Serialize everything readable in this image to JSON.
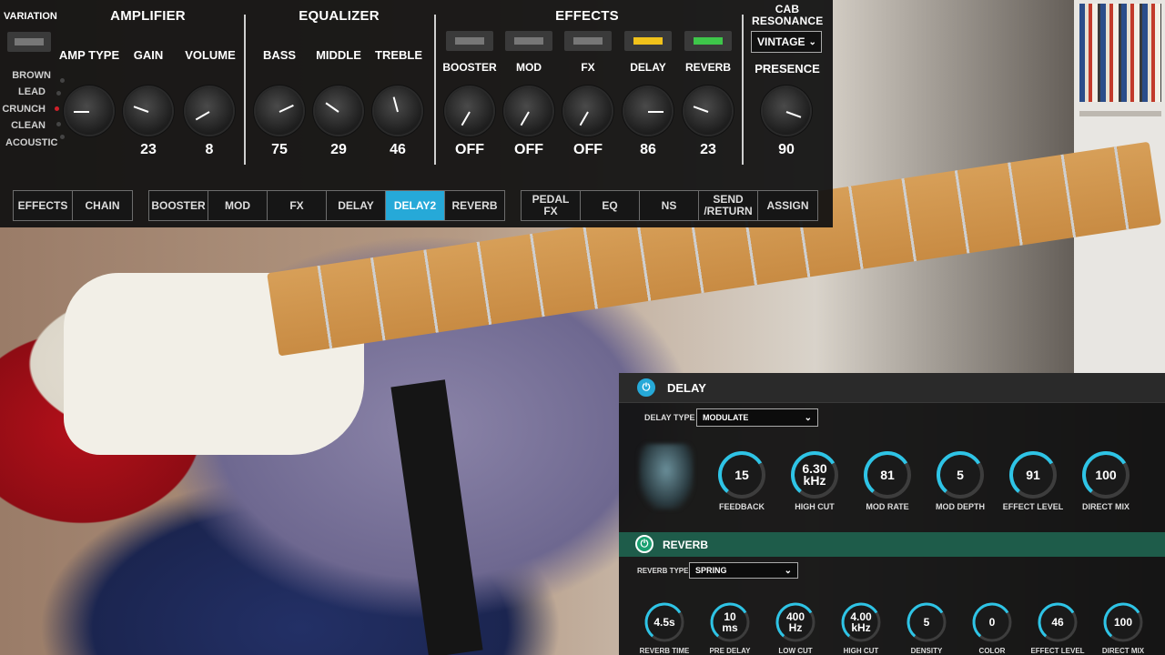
{
  "top": {
    "variation": "VARIATION",
    "amplifier": "AMPLIFIER",
    "equalizer": "EQUALIZER",
    "effects": "EFFECTS",
    "cab_resonance": "CAB\nRESONANCE",
    "amp_types": [
      "BROWN",
      "LEAD",
      "CRUNCH",
      "CLEAN",
      "ACOUSTIC"
    ],
    "amp_type_selected": "CRUNCH",
    "amp": {
      "amp_type": "AMP TYPE",
      "gain": "GAIN",
      "gain_val": "23",
      "volume": "VOLUME",
      "volume_val": "8"
    },
    "eq": {
      "bass": "BASS",
      "bass_val": "75",
      "middle": "MIDDLE",
      "middle_val": "29",
      "treble": "TREBLE",
      "treble_val": "46"
    },
    "fx": {
      "booster": "BOOSTER",
      "booster_val": "OFF",
      "mod": "MOD",
      "mod_val": "OFF",
      "fx": "FX",
      "fx_val": "OFF",
      "delay": "DELAY",
      "delay_val": "86",
      "reverb": "REVERB",
      "reverb_val": "23"
    },
    "cab": {
      "select": "VINTAGE",
      "presence": "PRESENCE",
      "presence_val": "90"
    },
    "led_colors": {
      "off": "#777777",
      "delay": "#f1c21b",
      "reverb": "#3ec64a"
    }
  },
  "tabs": {
    "group1": [
      "EFFECTS",
      "CHAIN"
    ],
    "group2": [
      "BOOSTER",
      "MOD",
      "FX",
      "DELAY",
      "DELAY2",
      "REVERB"
    ],
    "group3": [
      "PEDAL\nFX",
      "EQ",
      "NS",
      "SEND\n/RETURN",
      "ASSIGN"
    ],
    "active": "DELAY2",
    "active_color": "#26a9d8"
  },
  "delay": {
    "title": "DELAY",
    "type_label": "DELAY TYPE",
    "type_value": "MODULATE",
    "knobs": [
      {
        "label": "FEEDBACK",
        "value": "15"
      },
      {
        "label": "HIGH CUT",
        "value": "6.30\nkHz"
      },
      {
        "label": "MOD RATE",
        "value": "81"
      },
      {
        "label": "MOD DEPTH",
        "value": "5"
      },
      {
        "label": "EFFECT LEVEL",
        "value": "91"
      },
      {
        "label": "DIRECT MIX",
        "value": "100"
      }
    ]
  },
  "reverb": {
    "title": "REVERB",
    "type_label": "REVERB TYPE",
    "type_value": "SPRING",
    "knobs": [
      {
        "label": "REVERB TIME",
        "value": "4.5s"
      },
      {
        "label": "PRE DELAY",
        "value": "10\nms"
      },
      {
        "label": "LOW CUT",
        "value": "400\nHz"
      },
      {
        "label": "HIGH CUT",
        "value": "4.00\nkHz"
      },
      {
        "label": "DENSITY",
        "value": "5"
      },
      {
        "label": "COLOR",
        "value": "0"
      },
      {
        "label": "EFFECT LEVEL",
        "value": "46"
      },
      {
        "label": "DIRECT MIX",
        "value": "100"
      }
    ],
    "header_color": "#1e5c4a",
    "accent": "#2ec4e6"
  }
}
